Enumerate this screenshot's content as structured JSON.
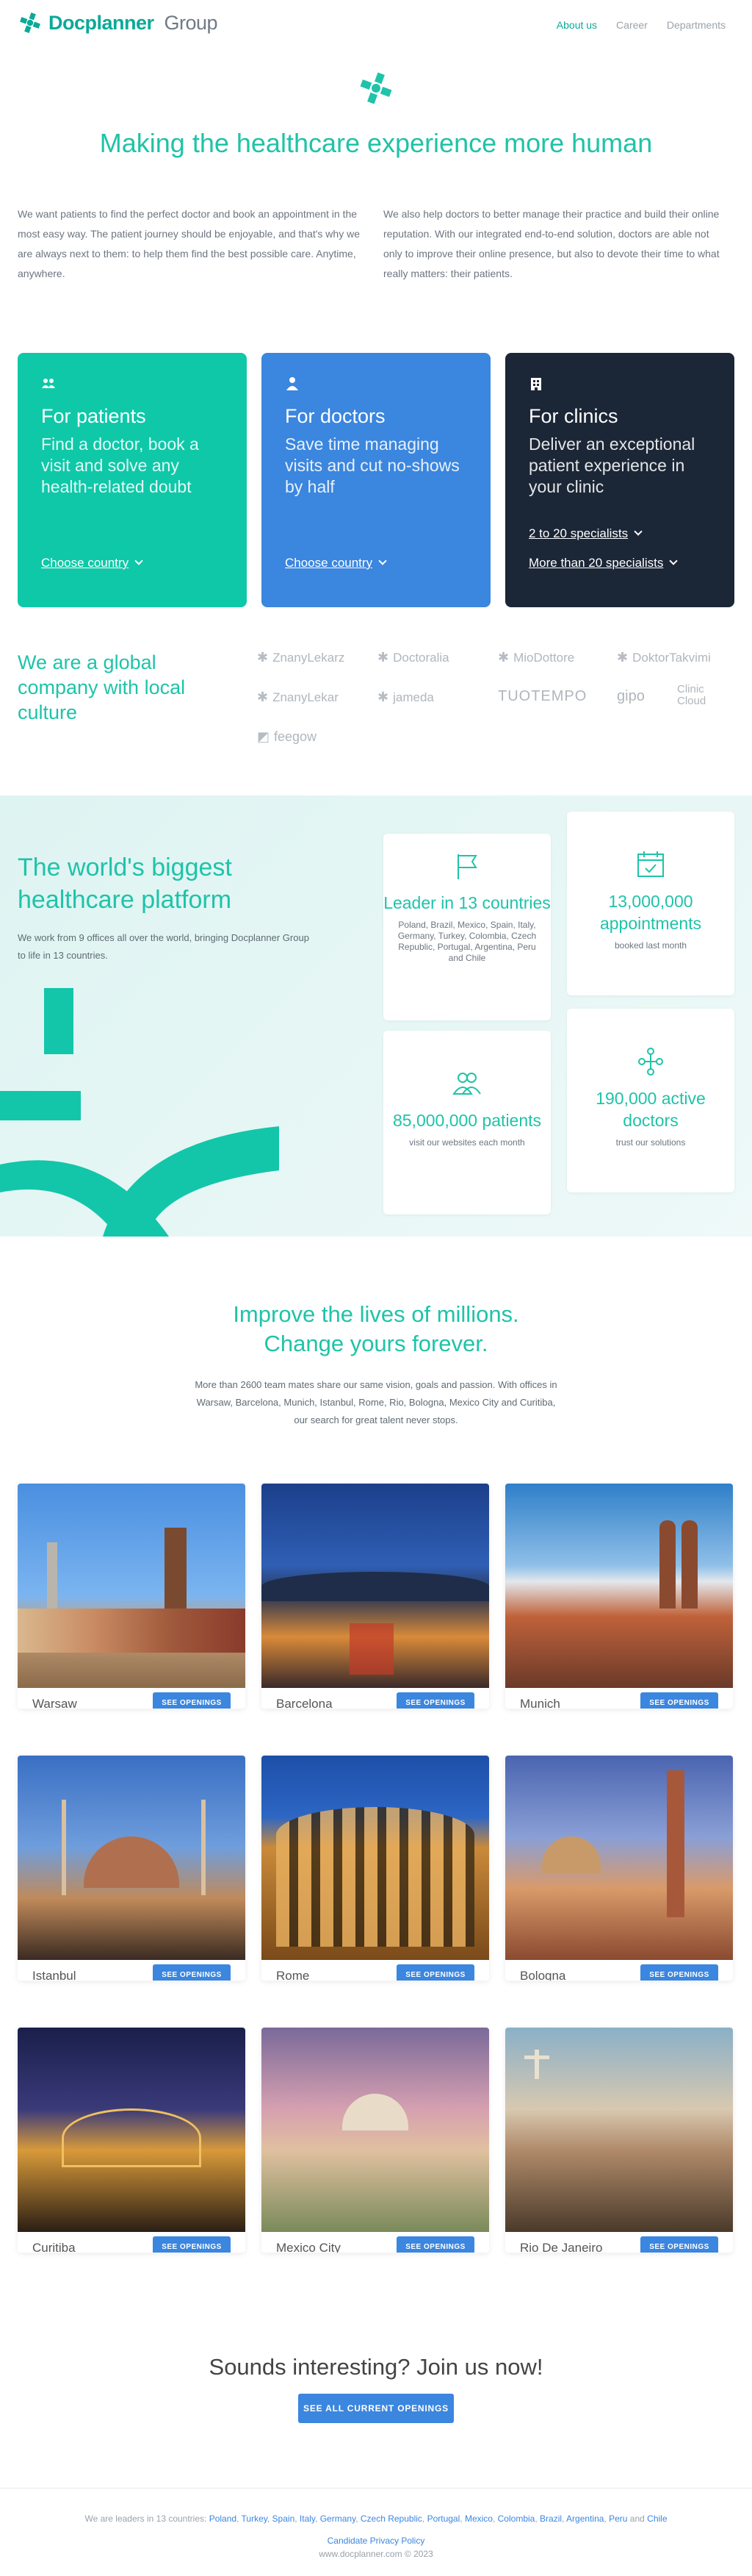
{
  "brand": {
    "name_bold": "Docplanner",
    "name_light": "Group"
  },
  "nav": {
    "items": [
      "About us",
      "Career",
      "Departments"
    ],
    "active": "About us"
  },
  "hero": {
    "title": "Making the healthcare experience more human",
    "intro_left": "We want patients to find the perfect doctor and book an appointment in the most easy way. The patient journey should be enjoyable, and that's why we are always next to them: to help them find the best possible care. Anytime, anywhere.",
    "intro_right": "We also help doctors to better manage their practice and build their online reputation. With our integrated end-to-end solution, doctors are able not only to improve their online presence, but also to devote their time to what really matters: their patients."
  },
  "cards": [
    {
      "title": "For patients",
      "desc": "Find a doctor, book a visit and solve any health-related doubt",
      "links": [
        "Choose country"
      ],
      "icon": "people-icon"
    },
    {
      "title": "For doctors",
      "desc": "Save time managing visits and cut no-shows by half",
      "links": [
        "Choose country"
      ],
      "icon": "doctor-icon"
    },
    {
      "title": "For clinics",
      "desc": "Deliver an exceptional patient experience in your clinic",
      "links": [
        "2 to 20 specialists",
        "More than 20 specialists"
      ],
      "icon": "building-icon"
    }
  ],
  "global": {
    "title": "We are a global company with local culture",
    "brands": [
      "ZnanyLekarz",
      "Doctoralia",
      "MioDottore",
      "DoktorTakvimi",
      "ZnanyLekar",
      "jameda",
      "TUOTEMPO",
      "gipo",
      "Clinic Cloud",
      "feegow"
    ]
  },
  "platform": {
    "title": "The world's biggest healthcare platform",
    "subtitle": "We work from 9 offices all over the world, bringing Docplanner Group to life in 13 countries.",
    "stats": [
      {
        "value": "Leader in 13 countries",
        "label": "Poland, Brazil, Mexico, Spain, Italy, Germany, Turkey, Colombia, Czech Republic, Portugal, Argentina, Peru and Chile",
        "icon": "flag-icon"
      },
      {
        "value": "13,000,000 appointments",
        "label": "booked last month",
        "icon": "calendar-icon"
      },
      {
        "value": "85,000,000 patients",
        "label": "visit our websites each month",
        "icon": "people-icon"
      },
      {
        "value": "190,000 active doctors",
        "label": "trust our solutions",
        "icon": "network-icon"
      }
    ]
  },
  "improve": {
    "title_line1": "Improve the lives of millions.",
    "title_line2": "Change yours forever.",
    "subtitle": "More than 2600 team mates share our same vision, goals and passion. With offices in Warsaw, Barcelona, Munich, Istanbul, Rome, Rio, Bologna, Mexico City and Curitiba, our search for great talent never stops."
  },
  "cities": [
    {
      "name": "Warsaw",
      "button": "SEE OPENINGS"
    },
    {
      "name": "Barcelona",
      "button": "SEE OPENINGS"
    },
    {
      "name": "Munich",
      "button": "SEE OPENINGS"
    },
    {
      "name": "Istanbul",
      "button": "SEE OPENINGS"
    },
    {
      "name": "Rome",
      "button": "SEE OPENINGS"
    },
    {
      "name": "Bologna",
      "button": "SEE OPENINGS"
    },
    {
      "name": "Curitiba",
      "button": "SEE OPENINGS"
    },
    {
      "name": "Mexico City",
      "button": "SEE OPENINGS"
    },
    {
      "name": "Rio De Janeiro",
      "button": "SEE OPENINGS"
    }
  ],
  "join": {
    "title": "Sounds interesting? Join us now!",
    "button": "SEE ALL CURRENT OPENINGS"
  },
  "footer": {
    "leaders_prefix": "We are leaders in 13 countries:",
    "countries": [
      "Poland",
      "Turkey",
      "Spain",
      "Italy",
      "Germany",
      "Czech Republic",
      "Portugal",
      "Mexico",
      "Colombia",
      "Brazil",
      "Argentina",
      "Peru",
      "Chile"
    ],
    "policy": "Candidate Privacy Policy",
    "copyright": "www.docplanner.com © 2023"
  },
  "colors": {
    "teal": "#1fc3a9",
    "blue": "#3b86de",
    "navy": "#1b2636",
    "card_teal": "#0fc8a8"
  }
}
